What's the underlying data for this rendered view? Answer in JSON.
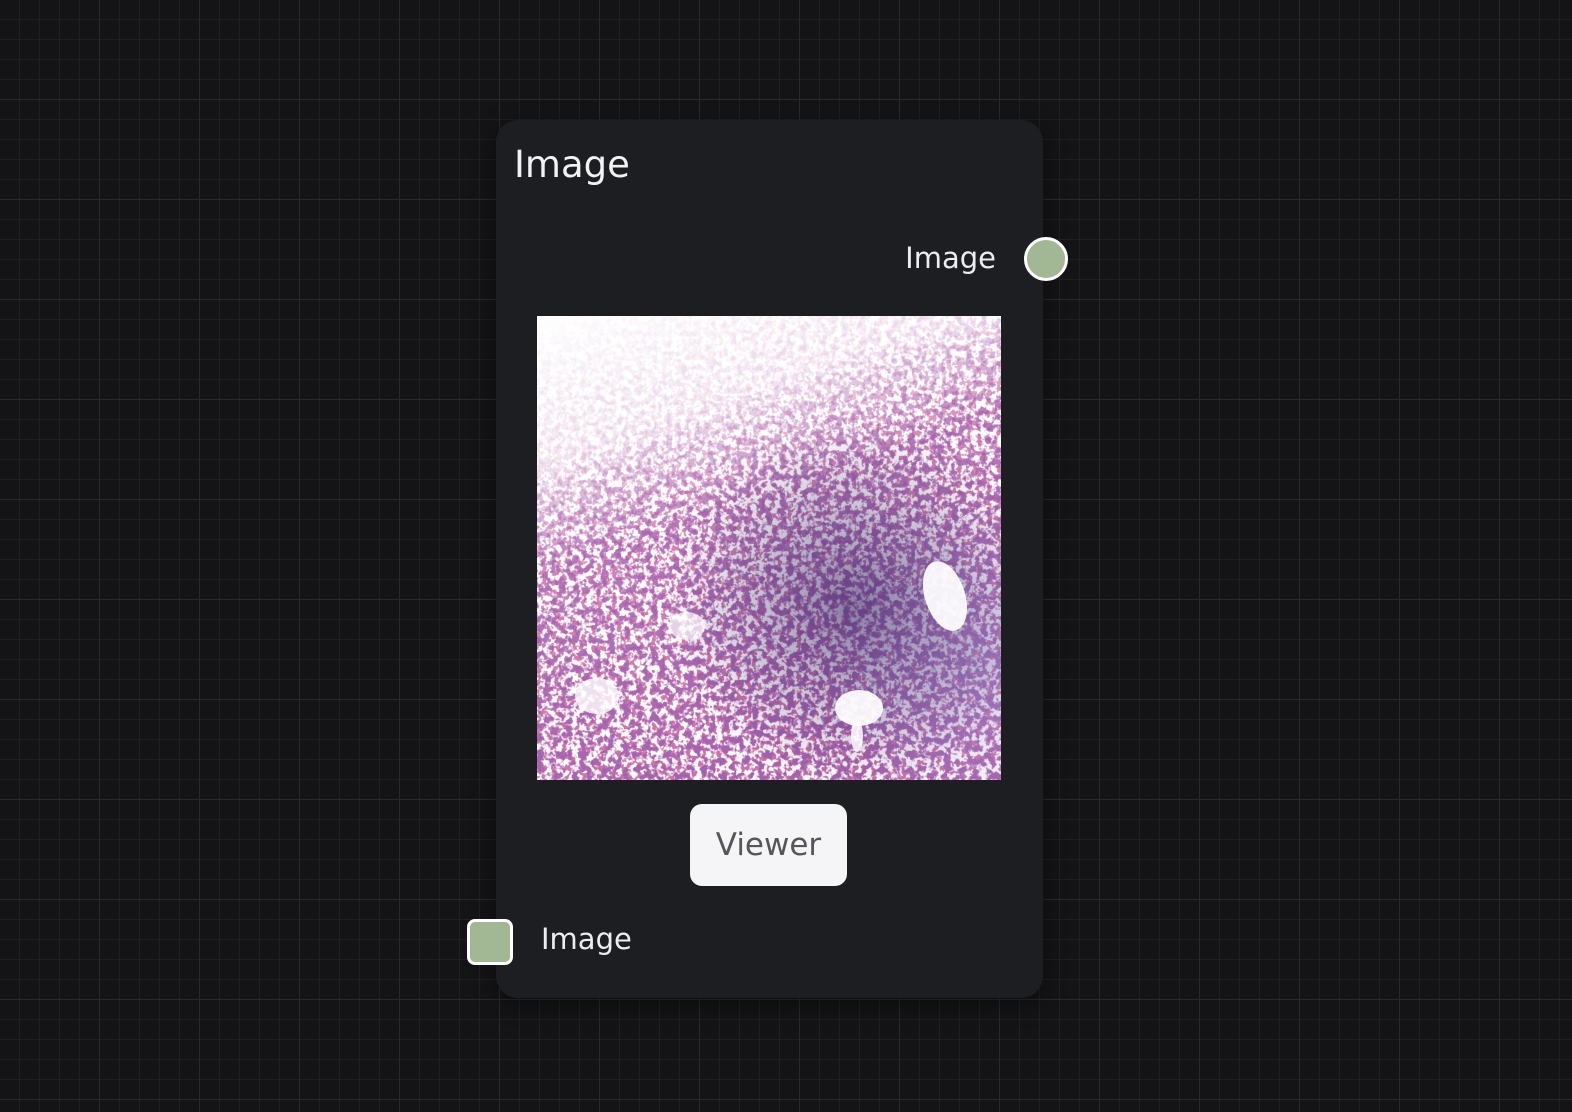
{
  "colors": {
    "canvas": "#141416",
    "node_background": "#1d1e21",
    "port_fill": "#a2b894",
    "port_border": "#ffffff",
    "button_background": "#f5f5f7"
  },
  "node": {
    "title": "Image",
    "output": {
      "label": "Image",
      "port_shape": "circle"
    },
    "preview": {
      "description_icon": "microscopy-image-preview"
    },
    "viewer_button": {
      "label": "Viewer"
    },
    "input": {
      "label": "Image",
      "port_shape": "square"
    }
  }
}
